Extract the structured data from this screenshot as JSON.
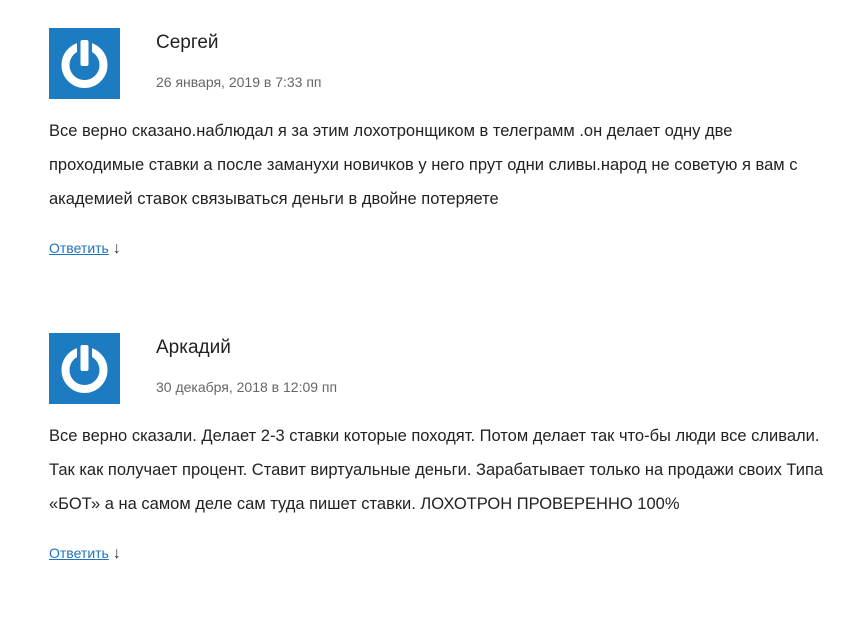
{
  "comments": [
    {
      "author": "Сергей",
      "date": "26 января, 2019 в 7:33 пп",
      "text": "Все верно сказано.наблюдал я за этим лохотронщиком в телеграмм .он делает одну две проходимые ставки а после заманухи новичков у него прут одни сливы.народ не советую я вам с академией ставок связываться деньги в двойне потеряете",
      "reply_label": "Ответить",
      "reply_arrow": "↓",
      "avatar_icon": "power-icon"
    },
    {
      "author": "Аркадий",
      "date": "30 декабря, 2018 в 12:09 пп",
      "text": "Все верно сказали. Делает 2-3 ставки которые походят. Потом делает так что-бы люди все сливали. Так как получает процент. Ставит виртуальные деньги. Зарабатывает только на продажи своих Типа «БОТ» а на самом деле сам туда пишет ставки. ЛОХОТРОН ПРОВЕРЕННО 100%",
      "reply_label": "Ответить",
      "reply_arrow": "↓",
      "avatar_icon": "power-icon"
    }
  ],
  "colors": {
    "avatar_bg": "#1c7bc1",
    "link": "#1e73be",
    "text": "#222222",
    "meta": "#666666"
  }
}
